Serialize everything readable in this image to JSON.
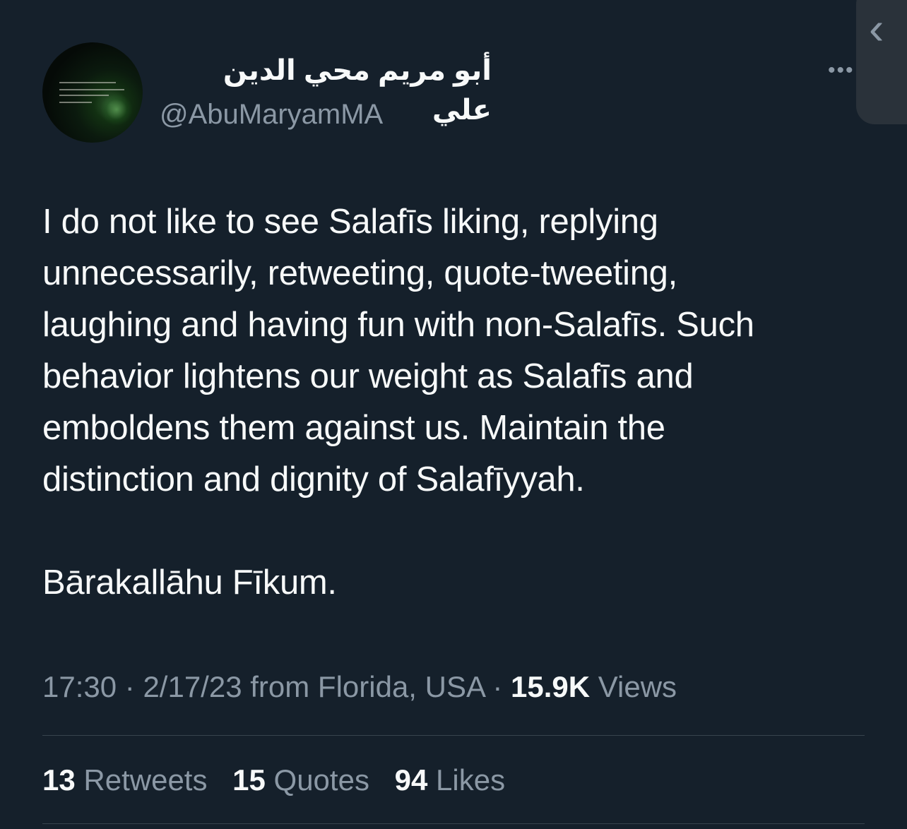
{
  "author": {
    "display_name": "أبو مريم محي الدين علي",
    "handle": "@AbuMaryamMA"
  },
  "icons": {
    "more": "more-horizontal-icon",
    "side_panel": "chevron-left-icon"
  },
  "tweet": {
    "text": "I do not like to see Salafīs liking, replying\nunnecessarily, retweeting, quote-tweeting,\nlaughing and having fun with non-Salafīs. Such\nbehavior lightens our weight as Salafīs and\nemboldens them against us. Maintain the\ndistinction and dignity of Salafīyyah.\n\nBārakallāhu Fīkum."
  },
  "meta": {
    "time": "17:30",
    "separator": " · ",
    "date": "2/17/23",
    "location": "from Florida, USA",
    "views_count": "15.9K",
    "views_label": "Views"
  },
  "stats": {
    "retweets_count": "13",
    "retweets_label": "Retweets",
    "quotes_count": "15",
    "quotes_label": "Quotes",
    "likes_count": "94",
    "likes_label": "Likes"
  },
  "colors": {
    "background": "#15202b",
    "text": "#f7f9f9",
    "secondary_text": "#8b98a5",
    "divider": "#38444d"
  }
}
